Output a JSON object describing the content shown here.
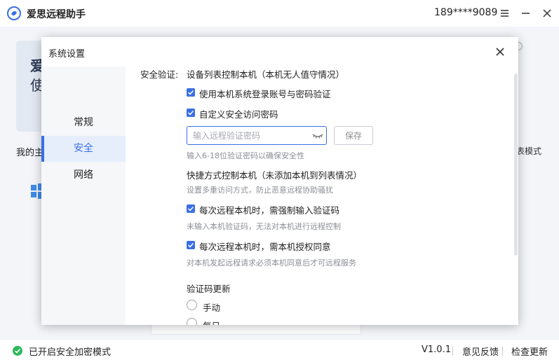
{
  "app": {
    "title": "爱思远程助手",
    "phone": "189****9089"
  },
  "background": {
    "card_title": "爱",
    "card_subtitle": "使",
    "my_label": "我的主",
    "right_label": "表模式"
  },
  "status": {
    "text": "已开启安全加密模式",
    "version": "V1.0.1",
    "feedback": "意见反馈",
    "update": "检查更新"
  },
  "dialog": {
    "title": "系统设置",
    "sidebar": [
      {
        "label": "常规"
      },
      {
        "label": "安全"
      },
      {
        "label": "网络"
      }
    ],
    "security": {
      "label": "安全验证:",
      "device_list_heading": "设备列表控制本机（本机无人值守情况）",
      "opt_login_account": "使用本机系统登录账号与密码验证",
      "opt_custom_pwd": "自定义安全访问密码",
      "pwd_placeholder": "输入远程验证密码",
      "save_button": "保存",
      "pwd_hint": "输入6-18位验证密码以确保安全性",
      "shortcut_heading": "快捷方式控制本机（未添加本机到列表情况）",
      "shortcut_hint": "设置多重访问方式，防止恶意远程协助骚扰",
      "opt_force_code": "每次远程本机时，需强制输入验证码",
      "force_code_hint": "未输入本机验证码，无法对本机进行远程控制",
      "opt_authorize": "每次远程本机时，需本机授权同意",
      "authorize_hint": "对本机发起远程请求必须本机同意后才可远程服务",
      "code_update_heading": "验证码更新",
      "radio_manual": "手动",
      "radio_daily": "每日"
    }
  },
  "colors": {
    "accent": "#3a6fe4",
    "status_ok": "#2fb85c"
  }
}
